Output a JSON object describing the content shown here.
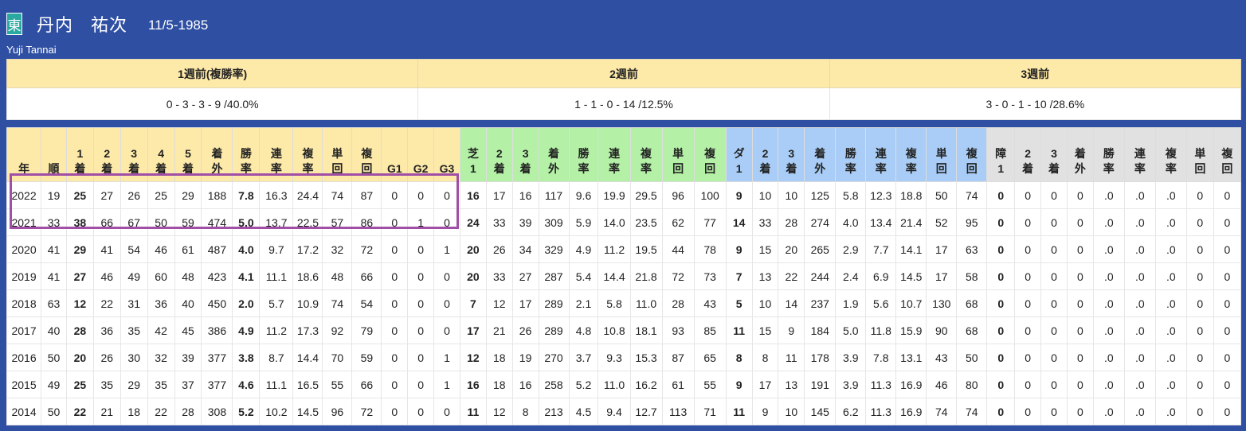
{
  "jockey": {
    "affiliation_badge": "東",
    "family_name": "丹内",
    "given_name": "祐次",
    "birth_date": "11/5-1985",
    "romaji": "Yuji Tannai"
  },
  "weeks": {
    "headers": [
      "1週前(複勝率)",
      "2週前",
      "3週前"
    ],
    "values": [
      "0 - 3 - 3 - 9 /40.0%",
      "1 - 1 - 0 - 14 /12.5%",
      "3 - 0 - 1 - 10 /28.6%"
    ]
  },
  "stats": {
    "headers": [
      {
        "l1": "",
        "l2": "年",
        "g": "g"
      },
      {
        "l1": "",
        "l2": "順",
        "g": "g"
      },
      {
        "l1": "1",
        "l2": "着",
        "g": "g"
      },
      {
        "l1": "2",
        "l2": "着",
        "g": "g"
      },
      {
        "l1": "3",
        "l2": "着",
        "g": "g"
      },
      {
        "l1": "4",
        "l2": "着",
        "g": "g"
      },
      {
        "l1": "5",
        "l2": "着",
        "g": "g"
      },
      {
        "l1": "着",
        "l2": "外",
        "g": "g"
      },
      {
        "l1": "勝",
        "l2": "率",
        "g": "g"
      },
      {
        "l1": "連",
        "l2": "率",
        "g": "g"
      },
      {
        "l1": "複",
        "l2": "率",
        "g": "g"
      },
      {
        "l1": "単",
        "l2": "回",
        "g": "g"
      },
      {
        "l1": "複",
        "l2": "回",
        "g": "g"
      },
      {
        "l1": "",
        "l2": "G1",
        "g": "g"
      },
      {
        "l1": "",
        "l2": "G2",
        "g": "g"
      },
      {
        "l1": "",
        "l2": "G3",
        "g": "g"
      },
      {
        "l1": "芝",
        "l2": "1",
        "g": "t"
      },
      {
        "l1": "2",
        "l2": "着",
        "g": "t"
      },
      {
        "l1": "3",
        "l2": "着",
        "g": "t"
      },
      {
        "l1": "着",
        "l2": "外",
        "g": "t"
      },
      {
        "l1": "勝",
        "l2": "率",
        "g": "t"
      },
      {
        "l1": "連",
        "l2": "率",
        "g": "t"
      },
      {
        "l1": "複",
        "l2": "率",
        "g": "t"
      },
      {
        "l1": "単",
        "l2": "回",
        "g": "t"
      },
      {
        "l1": "複",
        "l2": "回",
        "g": "t"
      },
      {
        "l1": "ダ",
        "l2": "1",
        "g": "d"
      },
      {
        "l1": "2",
        "l2": "着",
        "g": "d"
      },
      {
        "l1": "3",
        "l2": "着",
        "g": "d"
      },
      {
        "l1": "着",
        "l2": "外",
        "g": "d"
      },
      {
        "l1": "勝",
        "l2": "率",
        "g": "d"
      },
      {
        "l1": "連",
        "l2": "率",
        "g": "d"
      },
      {
        "l1": "複",
        "l2": "率",
        "g": "d"
      },
      {
        "l1": "単",
        "l2": "回",
        "g": "d"
      },
      {
        "l1": "複",
        "l2": "回",
        "g": "d"
      },
      {
        "l1": "障",
        "l2": "1",
        "g": "s"
      },
      {
        "l1": "2",
        "l2": "着",
        "g": "s"
      },
      {
        "l1": "3",
        "l2": "着",
        "g": "s"
      },
      {
        "l1": "着",
        "l2": "外",
        "g": "s"
      },
      {
        "l1": "勝",
        "l2": "率",
        "g": "s"
      },
      {
        "l1": "連",
        "l2": "率",
        "g": "s"
      },
      {
        "l1": "複",
        "l2": "率",
        "g": "s"
      },
      {
        "l1": "単",
        "l2": "回",
        "g": "s"
      },
      {
        "l1": "複",
        "l2": "回",
        "g": "s"
      }
    ],
    "bold_columns": [
      2,
      8,
      16,
      25,
      34
    ],
    "rows": [
      [
        "2022",
        "19",
        "25",
        "27",
        "26",
        "25",
        "29",
        "188",
        "7.8",
        "16.3",
        "24.4",
        "74",
        "87",
        "0",
        "0",
        "0",
        "16",
        "17",
        "16",
        "117",
        "9.6",
        "19.9",
        "29.5",
        "96",
        "100",
        "9",
        "10",
        "10",
        "125",
        "5.8",
        "12.3",
        "18.8",
        "50",
        "74",
        "0",
        "0",
        "0",
        "0",
        ".0",
        ".0",
        ".0",
        "0",
        "0"
      ],
      [
        "2021",
        "33",
        "38",
        "66",
        "67",
        "50",
        "59",
        "474",
        "5.0",
        "13.7",
        "22.5",
        "57",
        "86",
        "0",
        "1",
        "0",
        "24",
        "33",
        "39",
        "309",
        "5.9",
        "14.0",
        "23.5",
        "62",
        "77",
        "14",
        "33",
        "28",
        "274",
        "4.0",
        "13.4",
        "21.4",
        "52",
        "95",
        "0",
        "0",
        "0",
        "0",
        ".0",
        ".0",
        ".0",
        "0",
        "0"
      ],
      [
        "2020",
        "41",
        "29",
        "41",
        "54",
        "46",
        "61",
        "487",
        "4.0",
        "9.7",
        "17.2",
        "32",
        "72",
        "0",
        "0",
        "1",
        "20",
        "26",
        "34",
        "329",
        "4.9",
        "11.2",
        "19.5",
        "44",
        "78",
        "9",
        "15",
        "20",
        "265",
        "2.9",
        "7.7",
        "14.1",
        "17",
        "63",
        "0",
        "0",
        "0",
        "0",
        ".0",
        ".0",
        ".0",
        "0",
        "0"
      ],
      [
        "2019",
        "41",
        "27",
        "46",
        "49",
        "60",
        "48",
        "423",
        "4.1",
        "11.1",
        "18.6",
        "48",
        "66",
        "0",
        "0",
        "0",
        "20",
        "33",
        "27",
        "287",
        "5.4",
        "14.4",
        "21.8",
        "72",
        "73",
        "7",
        "13",
        "22",
        "244",
        "2.4",
        "6.9",
        "14.5",
        "17",
        "58",
        "0",
        "0",
        "0",
        "0",
        ".0",
        ".0",
        ".0",
        "0",
        "0"
      ],
      [
        "2018",
        "63",
        "12",
        "22",
        "31",
        "36",
        "40",
        "450",
        "2.0",
        "5.7",
        "10.9",
        "74",
        "54",
        "0",
        "0",
        "0",
        "7",
        "12",
        "17",
        "289",
        "2.1",
        "5.8",
        "11.0",
        "28",
        "43",
        "5",
        "10",
        "14",
        "237",
        "1.9",
        "5.6",
        "10.7",
        "130",
        "68",
        "0",
        "0",
        "0",
        "0",
        ".0",
        ".0",
        ".0",
        "0",
        "0"
      ],
      [
        "2017",
        "40",
        "28",
        "36",
        "35",
        "42",
        "45",
        "386",
        "4.9",
        "11.2",
        "17.3",
        "92",
        "79",
        "0",
        "0",
        "0",
        "17",
        "21",
        "26",
        "289",
        "4.8",
        "10.8",
        "18.1",
        "93",
        "85",
        "11",
        "15",
        "9",
        "184",
        "5.0",
        "11.8",
        "15.9",
        "90",
        "68",
        "0",
        "0",
        "0",
        "0",
        ".0",
        ".0",
        ".0",
        "0",
        "0"
      ],
      [
        "2016",
        "50",
        "20",
        "26",
        "30",
        "32",
        "39",
        "377",
        "3.8",
        "8.7",
        "14.4",
        "70",
        "59",
        "0",
        "0",
        "1",
        "12",
        "18",
        "19",
        "270",
        "3.7",
        "9.3",
        "15.3",
        "87",
        "65",
        "8",
        "8",
        "11",
        "178",
        "3.9",
        "7.8",
        "13.1",
        "43",
        "50",
        "0",
        "0",
        "0",
        "0",
        ".0",
        ".0",
        ".0",
        "0",
        "0"
      ],
      [
        "2015",
        "49",
        "25",
        "35",
        "29",
        "35",
        "37",
        "377",
        "4.6",
        "11.1",
        "16.5",
        "55",
        "66",
        "0",
        "0",
        "1",
        "16",
        "18",
        "16",
        "258",
        "5.2",
        "11.0",
        "16.2",
        "61",
        "55",
        "9",
        "17",
        "13",
        "191",
        "3.9",
        "11.3",
        "16.9",
        "46",
        "80",
        "0",
        "0",
        "0",
        "0",
        ".0",
        ".0",
        ".0",
        "0",
        "0"
      ],
      [
        "2014",
        "50",
        "22",
        "21",
        "18",
        "22",
        "28",
        "308",
        "5.2",
        "10.2",
        "14.5",
        "96",
        "72",
        "0",
        "0",
        "0",
        "11",
        "12",
        "8",
        "213",
        "4.5",
        "9.4",
        "12.7",
        "113",
        "71",
        "11",
        "9",
        "10",
        "145",
        "6.2",
        "11.3",
        "16.9",
        "74",
        "74",
        "0",
        "0",
        "0",
        "0",
        ".0",
        ".0",
        ".0",
        "0",
        "0"
      ]
    ],
    "highlight_color": "#a04ea6"
  },
  "colors": {
    "background": "#2f4fa3",
    "overall_header": "#fde9a8",
    "turf_header": "#b4f0a6",
    "dirt_header": "#a9cdf6",
    "jump_header": "#e1e1e1",
    "badge": "#2aa9a0"
  }
}
